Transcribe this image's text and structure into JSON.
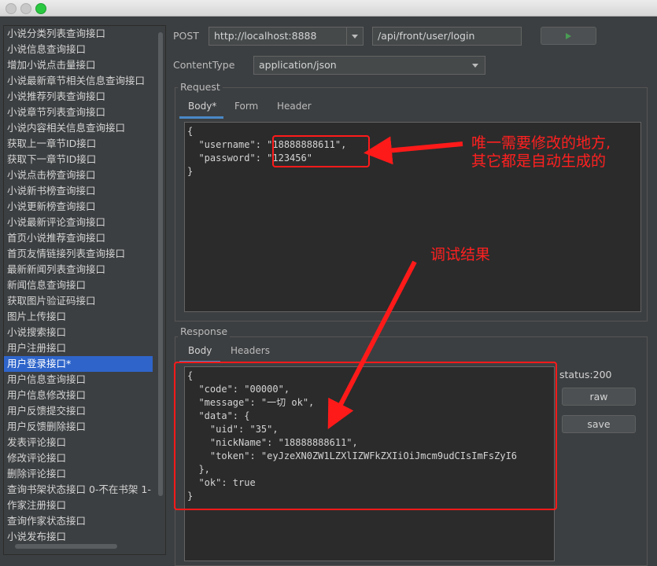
{
  "window": {
    "controls": [
      "close-button",
      "minimize-button",
      "zoom-button"
    ]
  },
  "sidebar": {
    "items": [
      "小说分类列表查询接口",
      "小说信息查询接口",
      "增加小说点击量接口",
      "小说最新章节相关信息查询接口",
      "小说推荐列表查询接口",
      "小说章节列表查询接口",
      "小说内容相关信息查询接口",
      "获取上一章节ID接口",
      "获取下一章节ID接口",
      "小说点击榜查询接口",
      "小说新书榜查询接口",
      "小说更新榜查询接口",
      "小说最新评论查询接口",
      "首页小说推荐查询接口",
      "首页友情链接列表查询接口",
      "最新新闻列表查询接口",
      "新闻信息查询接口",
      "获取图片验证码接口",
      "图片上传接口",
      "小说搜索接口",
      "用户注册接口",
      "用户登录接口*",
      "用户信息查询接口",
      "用户信息修改接口",
      "用户反馈提交接口",
      "用户反馈删除接口",
      "发表评论接口",
      "修改评论接口",
      "删除评论接口",
      "查询书架状态接口 0-不在书架 1-",
      "作家注册接口",
      "查询作家状态接口",
      "小说发布接口"
    ],
    "selected_index": 21
  },
  "request_line": {
    "method": "POST",
    "host": "http://localhost:8888",
    "path": "/api/front/user/login",
    "run_icon": "play-icon"
  },
  "content_type": {
    "label": "ContentType",
    "value": "application/json"
  },
  "request": {
    "title": "Request",
    "tabs": [
      "Body*",
      "Form",
      "Header"
    ],
    "active_tab": 0,
    "body_lines": [
      "{",
      "  \"username\": \"18888888611\",",
      "  \"password\": \"123456\"",
      "}"
    ]
  },
  "response": {
    "title": "Response",
    "tabs": [
      "Body",
      "Headers"
    ],
    "active_tab": 0,
    "status": "status:200",
    "raw_label": "raw",
    "save_label": "save",
    "body_lines": [
      "{",
      "  \"code\": \"00000\",",
      "  \"message\": \"一切 ok\",",
      "  \"data\": {",
      "    \"uid\": \"35\",",
      "    \"nickName\": \"18888888611\",",
      "    \"token\": \"eyJzeXN0ZW1LZXlIZWFkZXIiOiJmcm9udCIsImFsZyI6",
      "  },",
      "  \"ok\": true",
      "}"
    ]
  },
  "annotations": {
    "note1_line1": "唯一需要修改的地方,",
    "note1_line2": "其它都是自动生成的",
    "note2": "调试结果",
    "color": "#ff1a1a"
  }
}
